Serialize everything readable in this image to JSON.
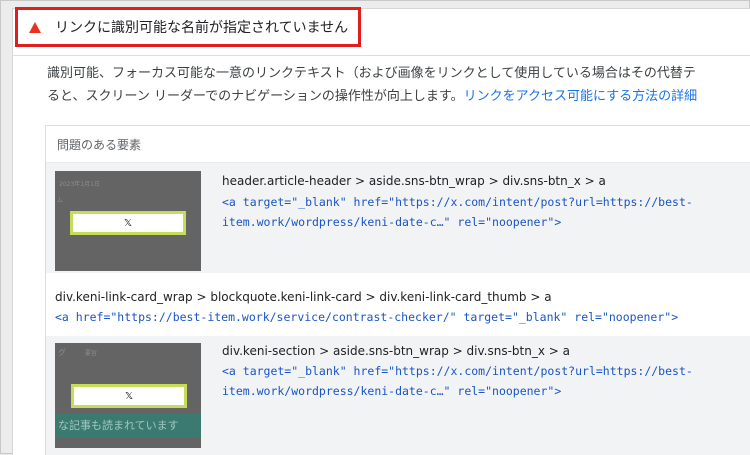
{
  "audit": {
    "title": "リンクに識別可能な名前が指定されていません",
    "description_line1": "識別可能、フォーカス可能な一意のリンクテキスト（および画像をリンクとして使用している場合はその代替テ",
    "description_line2": "ると、スクリーン リーダーでのナビゲーションの操作性が向上します。",
    "learn_more_link": "リンクをアクセス可能にする方法の詳細"
  },
  "table": {
    "header": "問題のある要素",
    "rows": [
      {
        "selector": "header.article-header > aside.sns-btn_wrap > div.sns-btn_x > a",
        "snippet_line1": "<a target=\"_blank\" href=\"https://x.com/intent/post?url=https://best-",
        "snippet_line2": "item.work/wordpress/keni-date-c…\" rel=\"noopener\">",
        "thumb_text": "𝕏",
        "thumb_ghost1": "2023年1月1日",
        "thumb_ghost2": "ム"
      },
      {
        "selector": "div.keni-link-card_wrap > blockquote.keni-link-card > div.keni-link-card_thumb > a",
        "snippet_line1": "<a href=\"https://best-item.work/service/contrast-checker/\" target=\"_blank\" rel=\"noopener\">"
      },
      {
        "selector": "div.keni-section > aside.sns-btn_wrap > div.sns-btn_x > a",
        "snippet_line1": "<a target=\"_blank\" href=\"https://x.com/intent/post?url=https://best-",
        "snippet_line2": "item.work/wordpress/keni-date-c…\" rel=\"noopener\">",
        "thumb_text": "𝕏",
        "thumb_ghost1": "グ",
        "thumb_ghost2": "要旨",
        "thumb_band": "な記事も読まれています"
      }
    ]
  },
  "colors": {
    "warning_red": "#e11d1d",
    "link_blue": "#1a73e8",
    "code_blue": "#1a55c6",
    "focus_outline": "#c8dc5a"
  }
}
